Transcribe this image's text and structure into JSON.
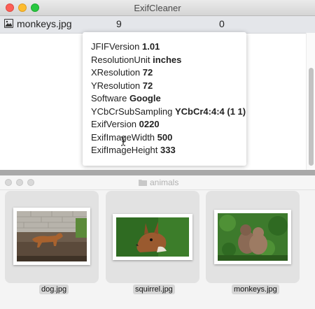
{
  "top_window": {
    "title": "ExifCleaner",
    "file_row": {
      "name": "monkeys.jpg",
      "count_a": "9",
      "count_b": "0"
    },
    "tooltip": [
      {
        "key": "JFIFVersion",
        "value": "1.01"
      },
      {
        "key": "ResolutionUnit",
        "value": "inches"
      },
      {
        "key": "XResolution",
        "value": "72"
      },
      {
        "key": "YResolution",
        "value": "72"
      },
      {
        "key": "Software",
        "value": "Google"
      },
      {
        "key": "YCbCrSubSampling",
        "value": "YCbCr4:4:4 (1 1)"
      },
      {
        "key": "ExifVersion",
        "value": "0220"
      },
      {
        "key": "ExifImageWidth",
        "value": "500"
      },
      {
        "key": "ExifImageHeight",
        "value": "333"
      }
    ]
  },
  "bottom_window": {
    "title": "animals",
    "files": [
      "dog.jpg",
      "squirrel.jpg",
      "monkeys.jpg"
    ]
  },
  "colors": {
    "close": "#fc5f57",
    "minimize": "#fdbc2e",
    "maximize": "#28c840",
    "file_row_bg": "#e4e6ea",
    "desktop_bg": "#a9a9a9"
  }
}
